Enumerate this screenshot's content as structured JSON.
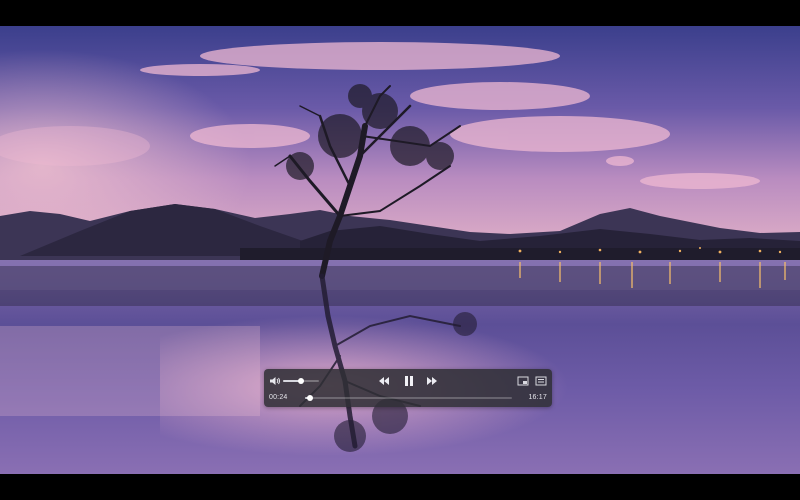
{
  "player": {
    "controls": {
      "volume": {
        "icon": "speaker-volume-icon",
        "level": 0.5
      },
      "rewind": {
        "icon": "rewind-icon"
      },
      "play_pause": {
        "icon": "pause-icon",
        "state": "playing"
      },
      "fast_forward": {
        "icon": "fast-forward-icon"
      },
      "picture_in_picture": {
        "icon": "picture-in-picture-icon"
      },
      "playlist": {
        "icon": "playlist-icon"
      },
      "progress": {
        "elapsed": "00:24",
        "total": "16:17",
        "fraction": 0.0245
      }
    }
  }
}
